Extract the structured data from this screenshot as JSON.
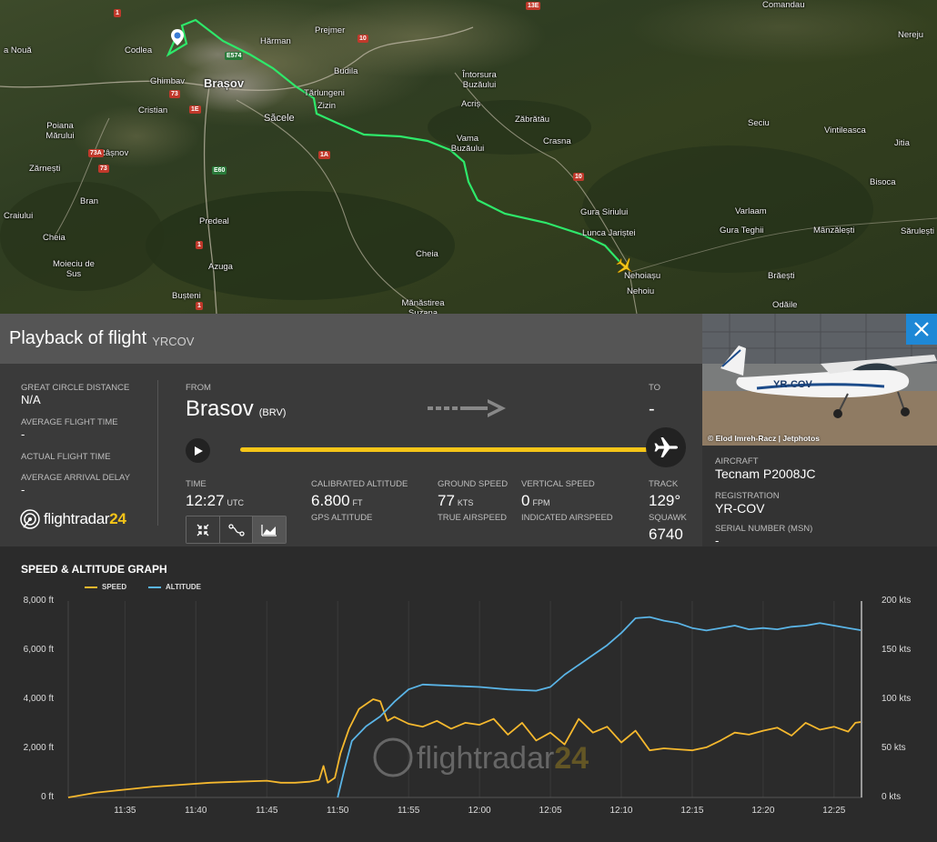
{
  "map": {
    "places": [
      {
        "name": "Codlea",
        "cls": ""
      },
      {
        "name": "Hărman",
        "cls": ""
      },
      {
        "name": "Prejmer",
        "cls": ""
      },
      {
        "name": "Ghimbav",
        "cls": ""
      },
      {
        "name": "Brașov",
        "cls": "big"
      },
      {
        "name": "Budila",
        "cls": ""
      },
      {
        "name": "Cristian",
        "cls": ""
      },
      {
        "name": "Tărlungeni",
        "cls": ""
      },
      {
        "name": "Zizin",
        "cls": ""
      },
      {
        "name": "Săcele",
        "cls": "mid"
      },
      {
        "name": "Întorsura Buzăului",
        "cls": ""
      },
      {
        "name": "Acriș",
        "cls": ""
      },
      {
        "name": "Poiana Mărului",
        "cls": ""
      },
      {
        "name": "Zărnești",
        "cls": ""
      },
      {
        "name": "Râșnov",
        "cls": ""
      },
      {
        "name": "Vama Buzăului",
        "cls": ""
      },
      {
        "name": "Zăbrătău",
        "cls": ""
      },
      {
        "name": "Crasna",
        "cls": ""
      },
      {
        "name": "Bran",
        "cls": ""
      },
      {
        "name": "Craiului",
        "cls": ""
      },
      {
        "name": "Predeal",
        "cls": ""
      },
      {
        "name": "Cheia",
        "cls": ""
      },
      {
        "name": "Cheia",
        "cls": ""
      },
      {
        "name": "Moieciu de Sus",
        "cls": ""
      },
      {
        "name": "Azuga",
        "cls": ""
      },
      {
        "name": "Bușteni",
        "cls": ""
      },
      {
        "name": "Mănăstirea Suzana",
        "cls": ""
      },
      {
        "name": "Gura Siriului",
        "cls": ""
      },
      {
        "name": "Lunca Jariștei",
        "cls": ""
      },
      {
        "name": "Nehoiașu",
        "cls": ""
      },
      {
        "name": "Nehoiu",
        "cls": ""
      },
      {
        "name": "Seciu",
        "cls": ""
      },
      {
        "name": "Vintileasca",
        "cls": ""
      },
      {
        "name": "Jitia",
        "cls": ""
      },
      {
        "name": "Bisoca",
        "cls": ""
      },
      {
        "name": "Varlaam",
        "cls": ""
      },
      {
        "name": "Gura Teghii",
        "cls": ""
      },
      {
        "name": "Mânzălești",
        "cls": ""
      },
      {
        "name": "Sărulești",
        "cls": ""
      },
      {
        "name": "Brăești",
        "cls": ""
      },
      {
        "name": "Odăile",
        "cls": ""
      },
      {
        "name": "Nereju",
        "cls": ""
      },
      {
        "name": "Comandau",
        "cls": ""
      },
      {
        "name": "a Nouă",
        "cls": ""
      }
    ],
    "roads": [
      "1",
      "13E",
      "10",
      "E574",
      "73",
      "1E",
      "73A",
      "73",
      "E60",
      "1A",
      "10",
      "1",
      "1"
    ]
  },
  "panel": {
    "title": "Playback of flight",
    "callsign": "YRCOV",
    "great_circle_label": "GREAT CIRCLE DISTANCE",
    "great_circle_value": "N/A",
    "avg_flight_time_label": "AVERAGE FLIGHT TIME",
    "avg_flight_time_value": "-",
    "actual_flight_time_label": "ACTUAL FLIGHT TIME",
    "avg_arrival_delay_label": "AVERAGE ARRIVAL DELAY",
    "avg_arrival_delay_value": "-",
    "from_label": "FROM",
    "from_city": "Brasov",
    "from_code": "(BRV)",
    "to_label": "TO",
    "to_value": "-",
    "playback_progress": 1.0,
    "time_label": "TIME",
    "time_value": "12:27",
    "time_unit": "UTC",
    "cal_alt_label": "CALIBRATED ALTITUDE",
    "cal_alt_value": "6.800",
    "cal_alt_unit": "FT",
    "gps_alt_label": "GPS ALTITUDE",
    "ground_speed_label": "GROUND SPEED",
    "ground_speed_value": "77",
    "ground_speed_unit": "KTS",
    "true_airspeed_label": "TRUE AIRSPEED",
    "vertical_speed_label": "VERTICAL SPEED",
    "vertical_speed_value": "0",
    "vertical_speed_unit": "FPM",
    "indicated_airspeed_label": "INDICATED AIRSPEED",
    "track_label": "TRACK",
    "track_value": "129°",
    "squawk_label": "SQUAWK",
    "squawk_value": "6740",
    "logo_a": "flightradar",
    "logo_b": "24"
  },
  "aircraft": {
    "photo_credit": "© Elod Imreh-Racz | Jetphotos",
    "photo_reg": "YR-COV",
    "aircraft_label": "AIRCRAFT",
    "aircraft_value": "Tecnam P2008JC",
    "registration_label": "REGISTRATION",
    "registration_value": "YR-COV",
    "msn_label": "SERIAL NUMBER (MSN)",
    "msn_value": "-"
  },
  "graph": {
    "title": "SPEED & ALTITUDE GRAPH",
    "legend_speed": "SPEED",
    "legend_altitude": "ALTITUDE",
    "watermark_a": "flightradar",
    "watermark_b": "24"
  },
  "colors": {
    "speed": "#f5b82e",
    "altitude": "#5ab4e6",
    "track": "#2ee86a",
    "accent": "#f5c518",
    "close": "#1e88d6"
  },
  "chart_data": {
    "type": "line",
    "x_unit": "time (UTC)",
    "xticks": [
      "11:35",
      "11:40",
      "11:45",
      "11:50",
      "11:55",
      "12:00",
      "12:05",
      "12:10",
      "12:15",
      "12:20",
      "12:25"
    ],
    "yticks_left": [
      "8,000 ft",
      "6,000 ft",
      "4,000 ft",
      "2,000 ft",
      "0 ft"
    ],
    "yticks_right": [
      "200 kts",
      "150 kts",
      "100 kts",
      "50 kts",
      "0 kts"
    ],
    "ylim_left": [
      0,
      8000
    ],
    "ylim_right": [
      0,
      200
    ],
    "xlim": [
      "11:31",
      "12:27"
    ],
    "grid": "vertical",
    "legend": "top-left",
    "series": [
      {
        "name": "SPEED",
        "axis": "right",
        "points": [
          [
            "11:31",
            0
          ],
          [
            "11:33",
            5
          ],
          [
            "11:35",
            8
          ],
          [
            "11:37",
            11
          ],
          [
            "11:39",
            13
          ],
          [
            "11:41",
            15
          ],
          [
            "11:43",
            16
          ],
          [
            "11:45",
            17
          ],
          [
            "11:46",
            15
          ],
          [
            "11:47",
            15
          ],
          [
            "11:48",
            16
          ],
          [
            "11:48.7",
            18
          ],
          [
            "11:49",
            32
          ],
          [
            "11:49.3",
            15
          ],
          [
            "11:49.8",
            20
          ],
          [
            "11:50.2",
            45
          ],
          [
            "11:50.8",
            70
          ],
          [
            "11:51.5",
            90
          ],
          [
            "11:52.5",
            100
          ],
          [
            "11:53",
            98
          ],
          [
            "11:53.5",
            78
          ],
          [
            "11:54",
            82
          ],
          [
            "11:55",
            75
          ],
          [
            "11:56",
            72
          ],
          [
            "11:57",
            78
          ],
          [
            "11:58",
            70
          ],
          [
            "11:59",
            76
          ],
          [
            "12:00",
            74
          ],
          [
            "12:01",
            80
          ],
          [
            "12:02",
            64
          ],
          [
            "12:03",
            76
          ],
          [
            "12:04",
            58
          ],
          [
            "12:05",
            66
          ],
          [
            "12:06",
            54
          ],
          [
            "12:07",
            80
          ],
          [
            "12:08",
            66
          ],
          [
            "12:09",
            72
          ],
          [
            "12:10",
            56
          ],
          [
            "12:11",
            68
          ],
          [
            "12:12",
            48
          ],
          [
            "12:13",
            50
          ],
          [
            "12:14",
            49
          ],
          [
            "12:15",
            48
          ],
          [
            "12:16",
            51
          ],
          [
            "12:17",
            58
          ],
          [
            "12:18",
            66
          ],
          [
            "12:19",
            64
          ],
          [
            "12:20",
            68
          ],
          [
            "12:21",
            71
          ],
          [
            "12:22",
            63
          ],
          [
            "12:23",
            76
          ],
          [
            "12:24",
            69
          ],
          [
            "12:25",
            72
          ],
          [
            "12:26",
            67
          ],
          [
            "12:26.5",
            76
          ],
          [
            "12:27",
            77
          ]
        ]
      },
      {
        "name": "ALTITUDE",
        "axis": "left",
        "points": [
          [
            "11:50",
            0
          ],
          [
            "11:50.5",
            1200
          ],
          [
            "11:51",
            2300
          ],
          [
            "11:52",
            2900
          ],
          [
            "11:53",
            3300
          ],
          [
            "11:54",
            3900
          ],
          [
            "11:55",
            4400
          ],
          [
            "11:56",
            4600
          ],
          [
            "11:58",
            4550
          ],
          [
            "12:00",
            4500
          ],
          [
            "12:02",
            4400
          ],
          [
            "12:04",
            4350
          ],
          [
            "12:05",
            4500
          ],
          [
            "12:06",
            5000
          ],
          [
            "12:07",
            5400
          ],
          [
            "12:08",
            5800
          ],
          [
            "12:09",
            6200
          ],
          [
            "12:10",
            6700
          ],
          [
            "12:11",
            7300
          ],
          [
            "12:12",
            7350
          ],
          [
            "12:13",
            7200
          ],
          [
            "12:14",
            7100
          ],
          [
            "12:15",
            6900
          ],
          [
            "12:16",
            6800
          ],
          [
            "12:17",
            6900
          ],
          [
            "12:18",
            7000
          ],
          [
            "12:19",
            6850
          ],
          [
            "12:20",
            6900
          ],
          [
            "12:21",
            6850
          ],
          [
            "12:22",
            6950
          ],
          [
            "12:23",
            7000
          ],
          [
            "12:24",
            7100
          ],
          [
            "12:25",
            7000
          ],
          [
            "12:26",
            6900
          ],
          [
            "12:27",
            6800
          ]
        ]
      }
    ]
  }
}
